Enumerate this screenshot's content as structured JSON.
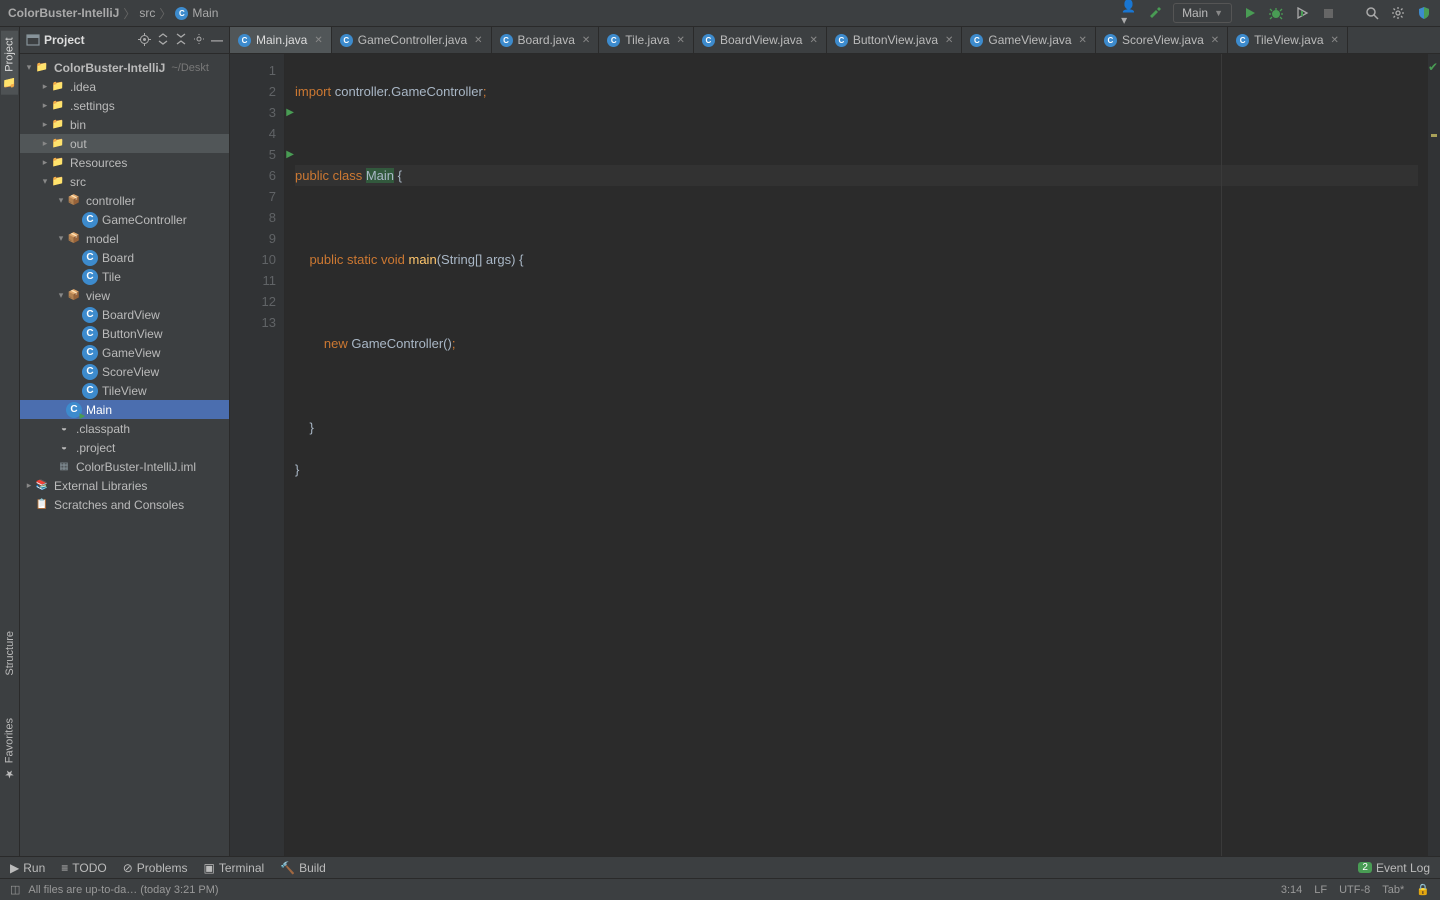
{
  "breadcrumb": {
    "project": "ColorBuster-IntelliJ",
    "folder": "src",
    "file": "Main"
  },
  "runConfig": "Main",
  "projectTool": {
    "title": "Project"
  },
  "tree": {
    "root": "ColorBuster-IntelliJ",
    "rootPath": "~/Deskt",
    "idea": ".idea",
    "settings": ".settings",
    "bin": "bin",
    "out": "out",
    "resources": "Resources",
    "src": "src",
    "controller": "controller",
    "gameController": "GameController",
    "model": "model",
    "board": "Board",
    "tile": "Tile",
    "view": "view",
    "boardView": "BoardView",
    "buttonView": "ButtonView",
    "gameView": "GameView",
    "scoreView": "ScoreView",
    "tileView": "TileView",
    "main": "Main",
    "classpath": ".classpath",
    "project": ".project",
    "iml": "ColorBuster-IntelliJ.iml",
    "extLib": "External Libraries",
    "scratches": "Scratches and Consoles"
  },
  "tabs": [
    "Main.java",
    "GameController.java",
    "Board.java",
    "Tile.java",
    "BoardView.java",
    "ButtonView.java",
    "GameView.java",
    "ScoreView.java",
    "TileView.java"
  ],
  "code": {
    "l1a": "import",
    "l1b": " controller.GameController",
    "l1c": ";",
    "l3a": "public class ",
    "l3b": "Main",
    "l3c": " {",
    "l5a": "    public static void ",
    "l5b": "main",
    "l5c": "(",
    "l5d": "String",
    "l5e": "[] args) {",
    "l7a": "        new ",
    "l7b": "GameController",
    "l7c": "()",
    ";": ";",
    "l9": "    }",
    "l10": "}"
  },
  "leftRail": {
    "project": "Project",
    "structure": "Structure",
    "fav": "Favorites"
  },
  "bottom": {
    "run": "Run",
    "todo": "TODO",
    "problems": "Problems",
    "terminal": "Terminal",
    "build": "Build",
    "event": "Event Log",
    "eventCount": "2"
  },
  "status": {
    "msg": "All files are up-to-da… (today 3:21 PM)",
    "pos": "3:14",
    "lf": "LF",
    "enc": "UTF-8",
    "tab": "Tab*"
  }
}
